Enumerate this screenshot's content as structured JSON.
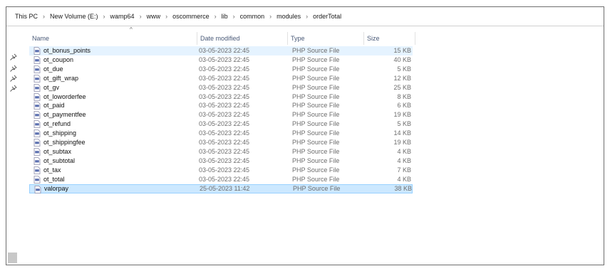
{
  "breadcrumb": [
    "This PC",
    "New Volume (E:)",
    "wamp64",
    "www",
    "oscommerce",
    "lib",
    "common",
    "modules",
    "orderTotal"
  ],
  "breadcrumb_separator": "›",
  "columns": {
    "name": "Name",
    "date": "Date modified",
    "type": "Type",
    "size": "Size",
    "sort_indicator": "^"
  },
  "files": [
    {
      "name": "ot_bonus_points",
      "date": "03-05-2023 22:45",
      "type": "PHP Source File",
      "size": "15 KB"
    },
    {
      "name": "ot_coupon",
      "date": "03-05-2023 22:45",
      "type": "PHP Source File",
      "size": "40 KB"
    },
    {
      "name": "ot_due",
      "date": "03-05-2023 22:45",
      "type": "PHP Source File",
      "size": "5 KB"
    },
    {
      "name": "ot_gift_wrap",
      "date": "03-05-2023 22:45",
      "type": "PHP Source File",
      "size": "12 KB"
    },
    {
      "name": "ot_gv",
      "date": "03-05-2023 22:45",
      "type": "PHP Source File",
      "size": "25 KB"
    },
    {
      "name": "ot_loworderfee",
      "date": "03-05-2023 22:45",
      "type": "PHP Source File",
      "size": "8 KB"
    },
    {
      "name": "ot_paid",
      "date": "03-05-2023 22:45",
      "type": "PHP Source File",
      "size": "6 KB"
    },
    {
      "name": "ot_paymentfee",
      "date": "03-05-2023 22:45",
      "type": "PHP Source File",
      "size": "19 KB"
    },
    {
      "name": "ot_refund",
      "date": "03-05-2023 22:45",
      "type": "PHP Source File",
      "size": "5 KB"
    },
    {
      "name": "ot_shipping",
      "date": "03-05-2023 22:45",
      "type": "PHP Source File",
      "size": "14 KB"
    },
    {
      "name": "ot_shippingfee",
      "date": "03-05-2023 22:45",
      "type": "PHP Source File",
      "size": "19 KB"
    },
    {
      "name": "ot_subtax",
      "date": "03-05-2023 22:45",
      "type": "PHP Source File",
      "size": "4 KB"
    },
    {
      "name": "ot_subtotal",
      "date": "03-05-2023 22:45",
      "type": "PHP Source File",
      "size": "4 KB"
    },
    {
      "name": "ot_tax",
      "date": "03-05-2023 22:45",
      "type": "PHP Source File",
      "size": "7 KB"
    },
    {
      "name": "ot_total",
      "date": "03-05-2023 22:45",
      "type": "PHP Source File",
      "size": "4 KB"
    },
    {
      "name": "valorpay",
      "date": "25-05-2023 11:42",
      "type": "PHP Source File",
      "size": "38 KB"
    }
  ],
  "colors": {
    "hover_row": "#e5f3ff",
    "selected_row": "#cce8ff",
    "selected_border": "#99d1ff",
    "header_text": "#4a5a78"
  }
}
